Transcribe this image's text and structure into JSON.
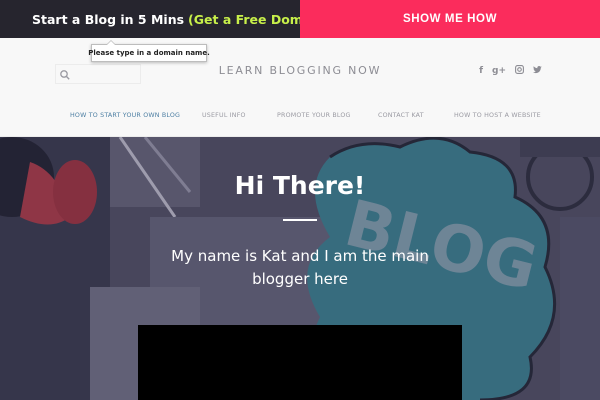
{
  "promo": {
    "lead": "Start a Blog in 5 Mins",
    "highlight": "(Get a Free Domain!)",
    "cta": "SHOW ME HOW",
    "colors": {
      "left_bg": "#26252e",
      "right_bg": "#fb2c5c",
      "highlight": "#c8f04a"
    }
  },
  "header": {
    "search": {
      "placeholder": "",
      "value": "",
      "icon": "search-icon"
    },
    "tooltip": "Please type in a domain name.",
    "site_title": "LEARN BLOGGING NOW",
    "social": [
      {
        "name": "facebook-icon",
        "glyph": "f"
      },
      {
        "name": "google-plus-icon",
        "glyph": "g+"
      },
      {
        "name": "instagram-icon",
        "glyph": "◙"
      },
      {
        "name": "twitter-icon",
        "glyph": "t"
      }
    ]
  },
  "nav": {
    "items": [
      {
        "label": "HOW TO START YOUR OWN BLOG",
        "active": true
      },
      {
        "label": "USEFUL INFO",
        "active": false
      },
      {
        "label": "PROMOTE YOUR BLOG",
        "active": false
      },
      {
        "label": "CONTACT KAT",
        "active": false
      },
      {
        "label": "HOW TO HOST A WEBSITE",
        "active": false
      }
    ],
    "colors": {
      "active": "#4d7fa3",
      "inactive": "#9a9aa2"
    }
  },
  "hero": {
    "title": "Hi There!",
    "subtitle": "My name is Kat and I am the main blogger here",
    "background_word": "BLOG"
  }
}
